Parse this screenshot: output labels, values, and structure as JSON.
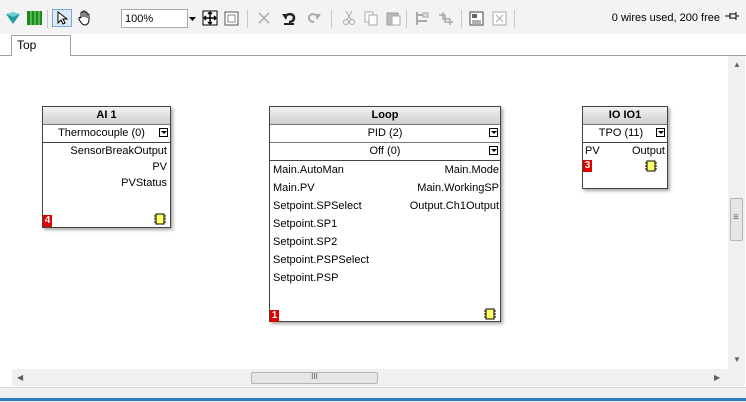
{
  "toolbar": {
    "zoom_value": "100%",
    "wires_status": "0 wires used, 200 free",
    "icons": [
      "palette-icon",
      "grid-icon",
      "pointer-icon",
      "hand-icon",
      "fit-icon",
      "frame-icon",
      "delete-icon",
      "undo-icon",
      "redo-icon",
      "cut-icon",
      "copy-icon",
      "paste-icon",
      "align-icon",
      "route-icon",
      "page-icon",
      "expand-icon",
      "pin-icon"
    ]
  },
  "tabs": [
    {
      "label": "Top",
      "active": true
    }
  ],
  "blocks": {
    "ai1": {
      "title": "AI 1",
      "params": [
        "Thermocouple (0)"
      ],
      "outputs": [
        "SensorBreakOutput",
        "PV",
        "PVStatus"
      ],
      "order": "4"
    },
    "loop": {
      "title": "Loop",
      "params": [
        "PID (2)",
        "Off (0)"
      ],
      "inputs": [
        "Main.AutoMan",
        "Main.PV",
        "Setpoint.SPSelect",
        "Setpoint.SP1",
        "Setpoint.SP2",
        "Setpoint.PSPSelect",
        "Setpoint.PSP"
      ],
      "outputs": [
        "Main.Mode",
        "Main.WorkingSP",
        "Output.Ch1Output"
      ],
      "order": "1"
    },
    "io1": {
      "title": "IO IO1",
      "params": [
        "TPO (11)"
      ],
      "input": "PV",
      "output": "Output",
      "order": "3"
    }
  },
  "scrollbar": {
    "h_thumb_label": "III",
    "v_thumb_label": "≡"
  },
  "colors": {
    "badge": "#e00000",
    "chip": "#ffff66",
    "accent_blue": "#2d79c4"
  }
}
